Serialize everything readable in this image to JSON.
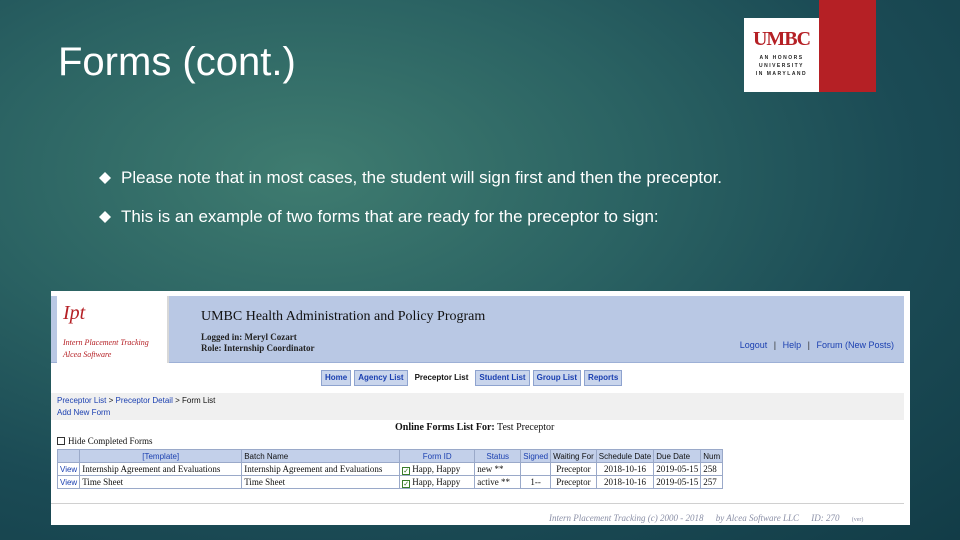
{
  "slide": {
    "title": "Forms (cont.)",
    "logo": {
      "main": "UMBC",
      "sub_lines": [
        "AN HONORS",
        "UNIVERSITY",
        "IN MARYLAND"
      ]
    },
    "bullets": [
      "Please note that in most cases, the student will sign first and then the preceptor.",
      "This is an example of two forms that are ready for the preceptor to sign:"
    ]
  },
  "app": {
    "brand_logo": "Ipt",
    "brand_name": "Intern Placement Tracking",
    "brand_company": "Alcea Software",
    "title": "UMBC Health Administration and Policy Program",
    "logged_in": "Logged in: Meryl Cozart",
    "role": "Role: Internship Coordinator",
    "top_links": [
      "Logout",
      "Help",
      "Forum (New Posts)"
    ],
    "tabs": [
      "Home",
      "Agency List",
      "Preceptor List",
      "Student List",
      "Group List",
      "Reports"
    ],
    "active_tab": "Preceptor List",
    "breadcrumb": [
      "Preceptor List",
      "Preceptor Detail",
      "Form List"
    ],
    "breadcrumb_sep": ">",
    "add_form": "Add New Form",
    "list_title_label": "Online Forms List For:",
    "list_title_value": "Test Preceptor",
    "hide_completed": "Hide Completed Forms",
    "table": {
      "headers": [
        "",
        "[Template]",
        "Batch Name",
        "Form ID",
        "Status",
        "Signed",
        "Waiting For",
        "Schedule Date",
        "Due Date",
        "Num"
      ],
      "rows": [
        [
          "View",
          "Internship Agreement and Evaluations",
          "Internship Agreement and Evaluations",
          "Happ, Happy",
          "new **",
          "",
          "Preceptor",
          "2018-10-16",
          "2019-05-15",
          "258"
        ],
        [
          "View",
          "Time Sheet",
          "Time Sheet",
          "Happ, Happy",
          "active **",
          "1--",
          "Preceptor",
          "2018-10-16",
          "2019-05-15",
          "257"
        ]
      ]
    },
    "footer": {
      "copyright": "Intern Placement Tracking (c) 2000 - 2018",
      "company": "by Alcea Software LLC",
      "id": "ID: 270",
      "small": "(ver)"
    }
  },
  "colors": {
    "background": "#1b4b55",
    "umbc_red": "#b52025",
    "header_blue": "#b9c8e4",
    "link_blue": "#1a3fb0"
  }
}
